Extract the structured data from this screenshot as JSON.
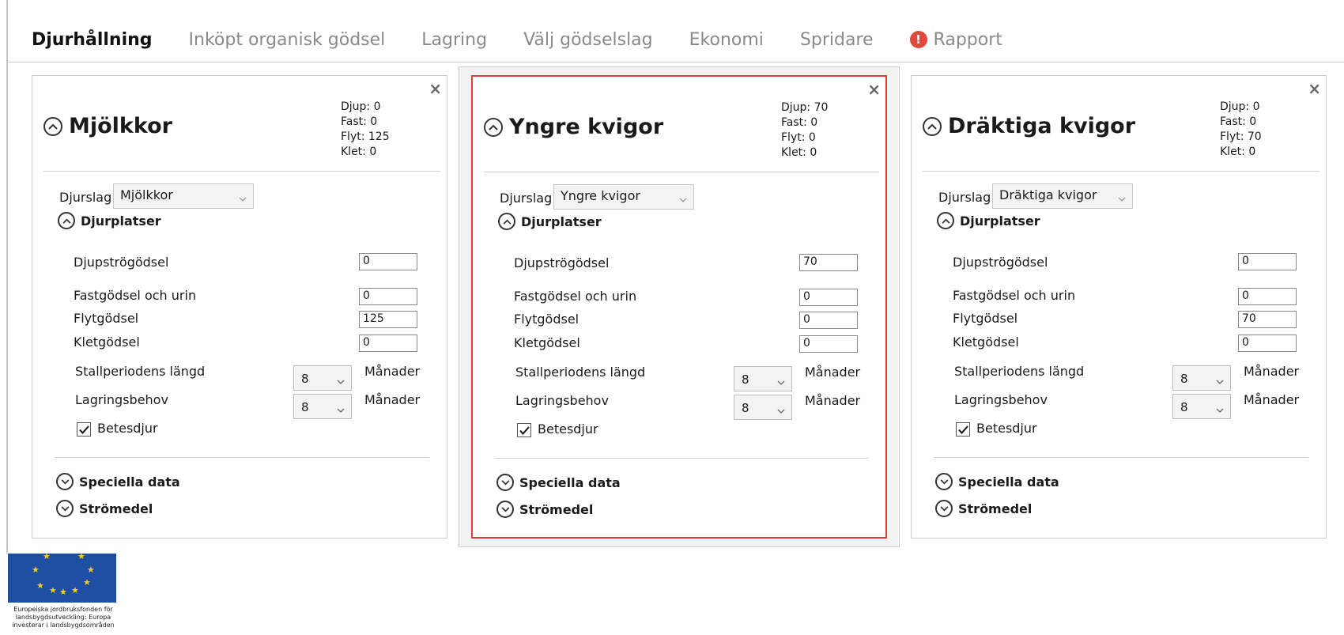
{
  "tabs": [
    {
      "label": "Djurhållning",
      "active": true
    },
    {
      "label": "Inköpt organisk gödsel"
    },
    {
      "label": "Lagring"
    },
    {
      "label": "Välj gödselslag"
    },
    {
      "label": "Ekonomi"
    },
    {
      "label": "Spridare"
    },
    {
      "label": "Rapport",
      "warning_icon": "alert-icon"
    }
  ],
  "warning_symbol": "!",
  "close_symbol": "×",
  "accent_color": "#e23b3b",
  "labels": {
    "djurslag": "Djurslag",
    "djurplatser": "Djurplatser",
    "djupstro": "Djupströgödsel",
    "fast": "Fastgödsel och urin",
    "flyt": "Flytgödsel",
    "klet": "Kletgödsel",
    "stallperiod": "Stallperiodens längd",
    "lagringsbehov": "Lagringsbehov",
    "manader": "Månader",
    "betesdjur": "Betesdjur",
    "speciella": "Speciella data",
    "stromedel": "Strömedel"
  },
  "cards": [
    {
      "title": "Mjölkkor",
      "stats": {
        "djup": "Djup: 0",
        "fast": "Fast: 0",
        "flyt": "Flyt: 125",
        "klet": "Klet: 0"
      },
      "djurslag": "Mjölkkor",
      "values": {
        "djupstro": "0",
        "fast": "0",
        "flyt": "125",
        "klet": "0"
      },
      "stallperiod": "8",
      "lagringsbehov": "8",
      "betesdjur": true,
      "selected": false
    },
    {
      "title": "Yngre kvigor",
      "stats": {
        "djup": "Djup: 70",
        "fast": "Fast: 0",
        "flyt": "Flyt: 0",
        "klet": "Klet: 0"
      },
      "djurslag": "Yngre kvigor",
      "values": {
        "djupstro": "70",
        "fast": "0",
        "flyt": "0",
        "klet": "0"
      },
      "stallperiod": "8",
      "lagringsbehov": "8",
      "betesdjur": true,
      "selected": true
    },
    {
      "title": "Dräktiga kvigor",
      "stats": {
        "djup": "Djup: 0",
        "fast": "Fast: 0",
        "flyt": "Flyt: 70",
        "klet": "Klet: 0"
      },
      "djurslag": "Dräktiga kvigor",
      "values": {
        "djupstro": "0",
        "fast": "0",
        "flyt": "70",
        "klet": "0"
      },
      "stallperiod": "8",
      "lagringsbehov": "8",
      "betesdjur": true,
      "selected": false
    }
  ],
  "footer": {
    "logo_icon": "eu-flag-icon",
    "caption": "Europeiska jordbruksfonden för landsbygdsutveckling: Europa investerar i landsbygdsområden"
  }
}
